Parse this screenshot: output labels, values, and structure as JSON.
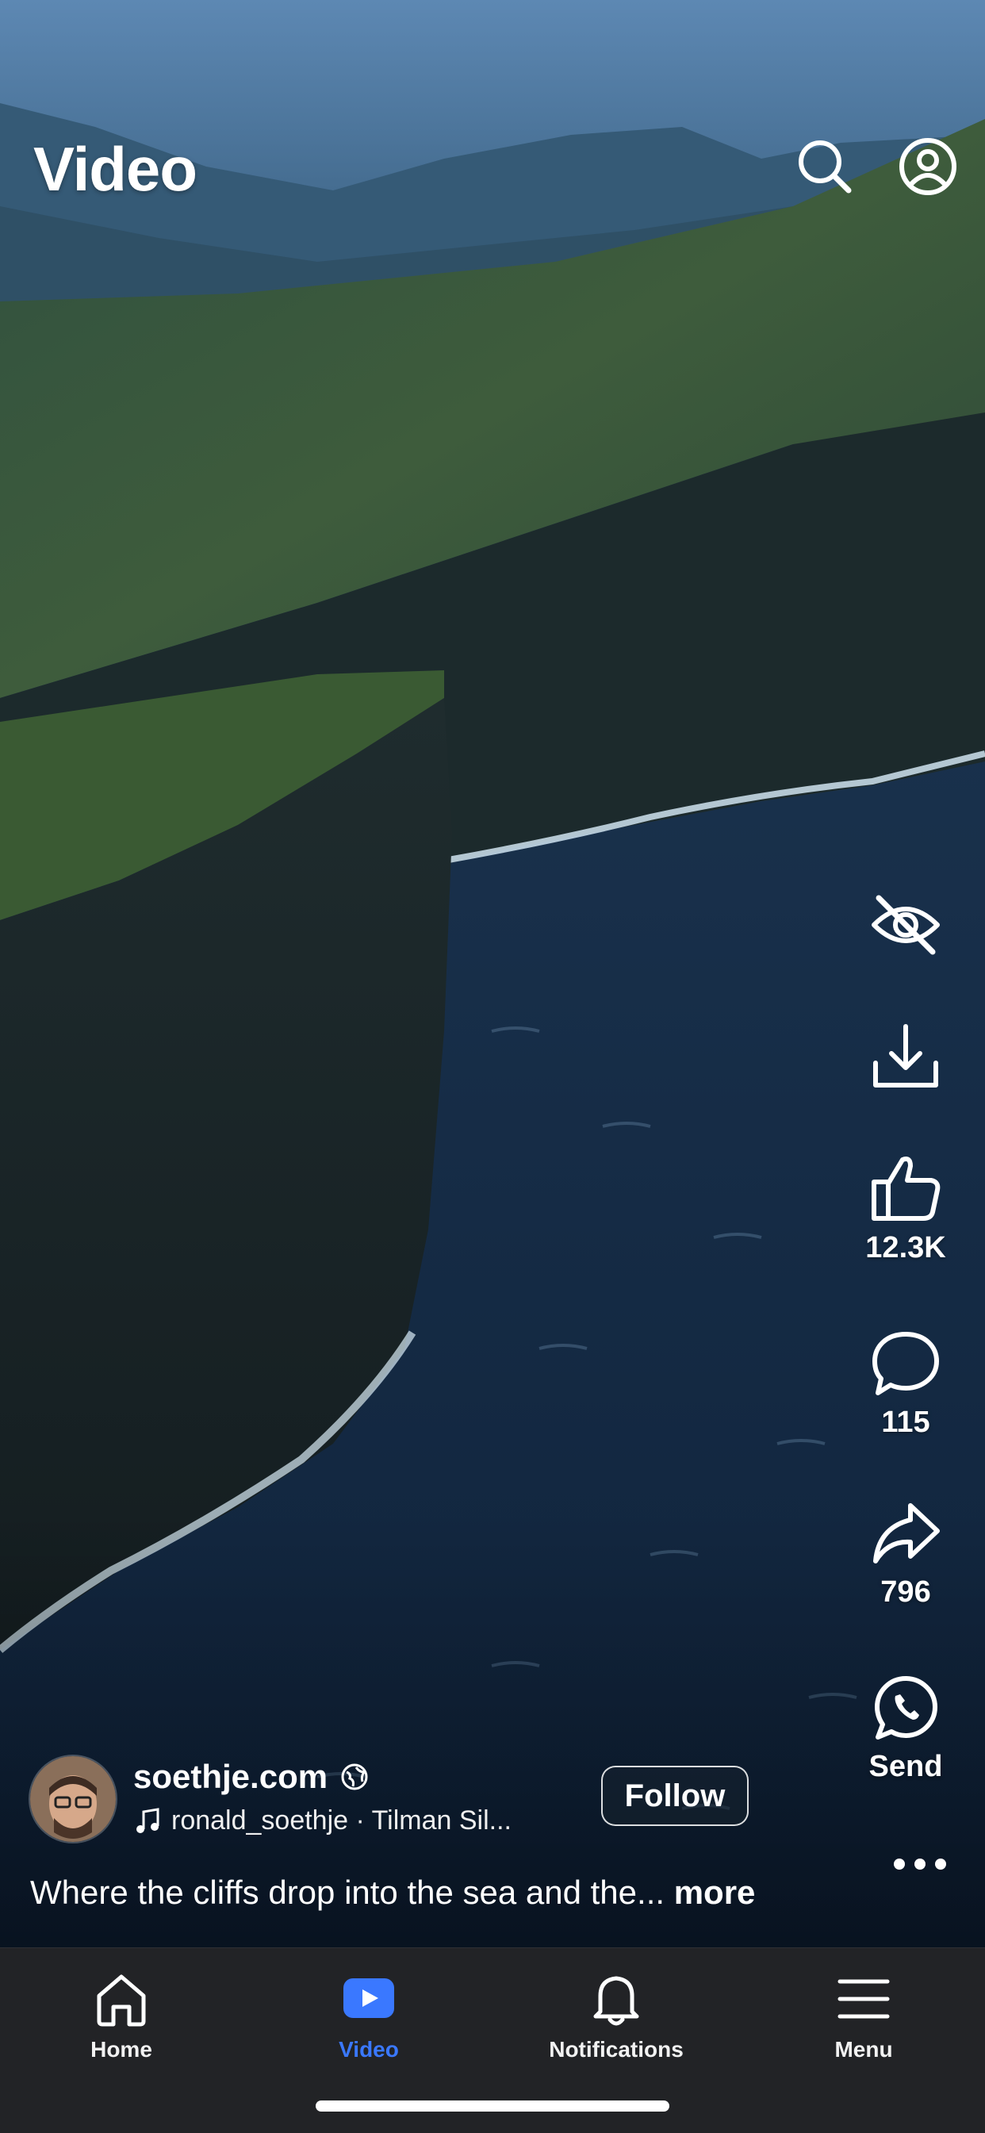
{
  "header": {
    "title": "Video"
  },
  "actions": {
    "like_count": "12.3K",
    "comment_count": "115",
    "share_count": "796",
    "send_label": "Send"
  },
  "post": {
    "author": "soethje.com",
    "audio": "ronald_soethje · Tilman Sil...",
    "follow_label": "Follow",
    "caption": "Where the cliffs drop into the sea and the...",
    "more_label": "more"
  },
  "tabs": [
    {
      "label": "Home",
      "icon": "home-icon"
    },
    {
      "label": "Video",
      "icon": "video-icon",
      "active": true
    },
    {
      "label": "Notifications",
      "icon": "bell-icon"
    },
    {
      "label": "Menu",
      "icon": "menu-icon"
    }
  ],
  "colors": {
    "accent": "#3a78ff",
    "tabbar_bg": "#222326"
  }
}
